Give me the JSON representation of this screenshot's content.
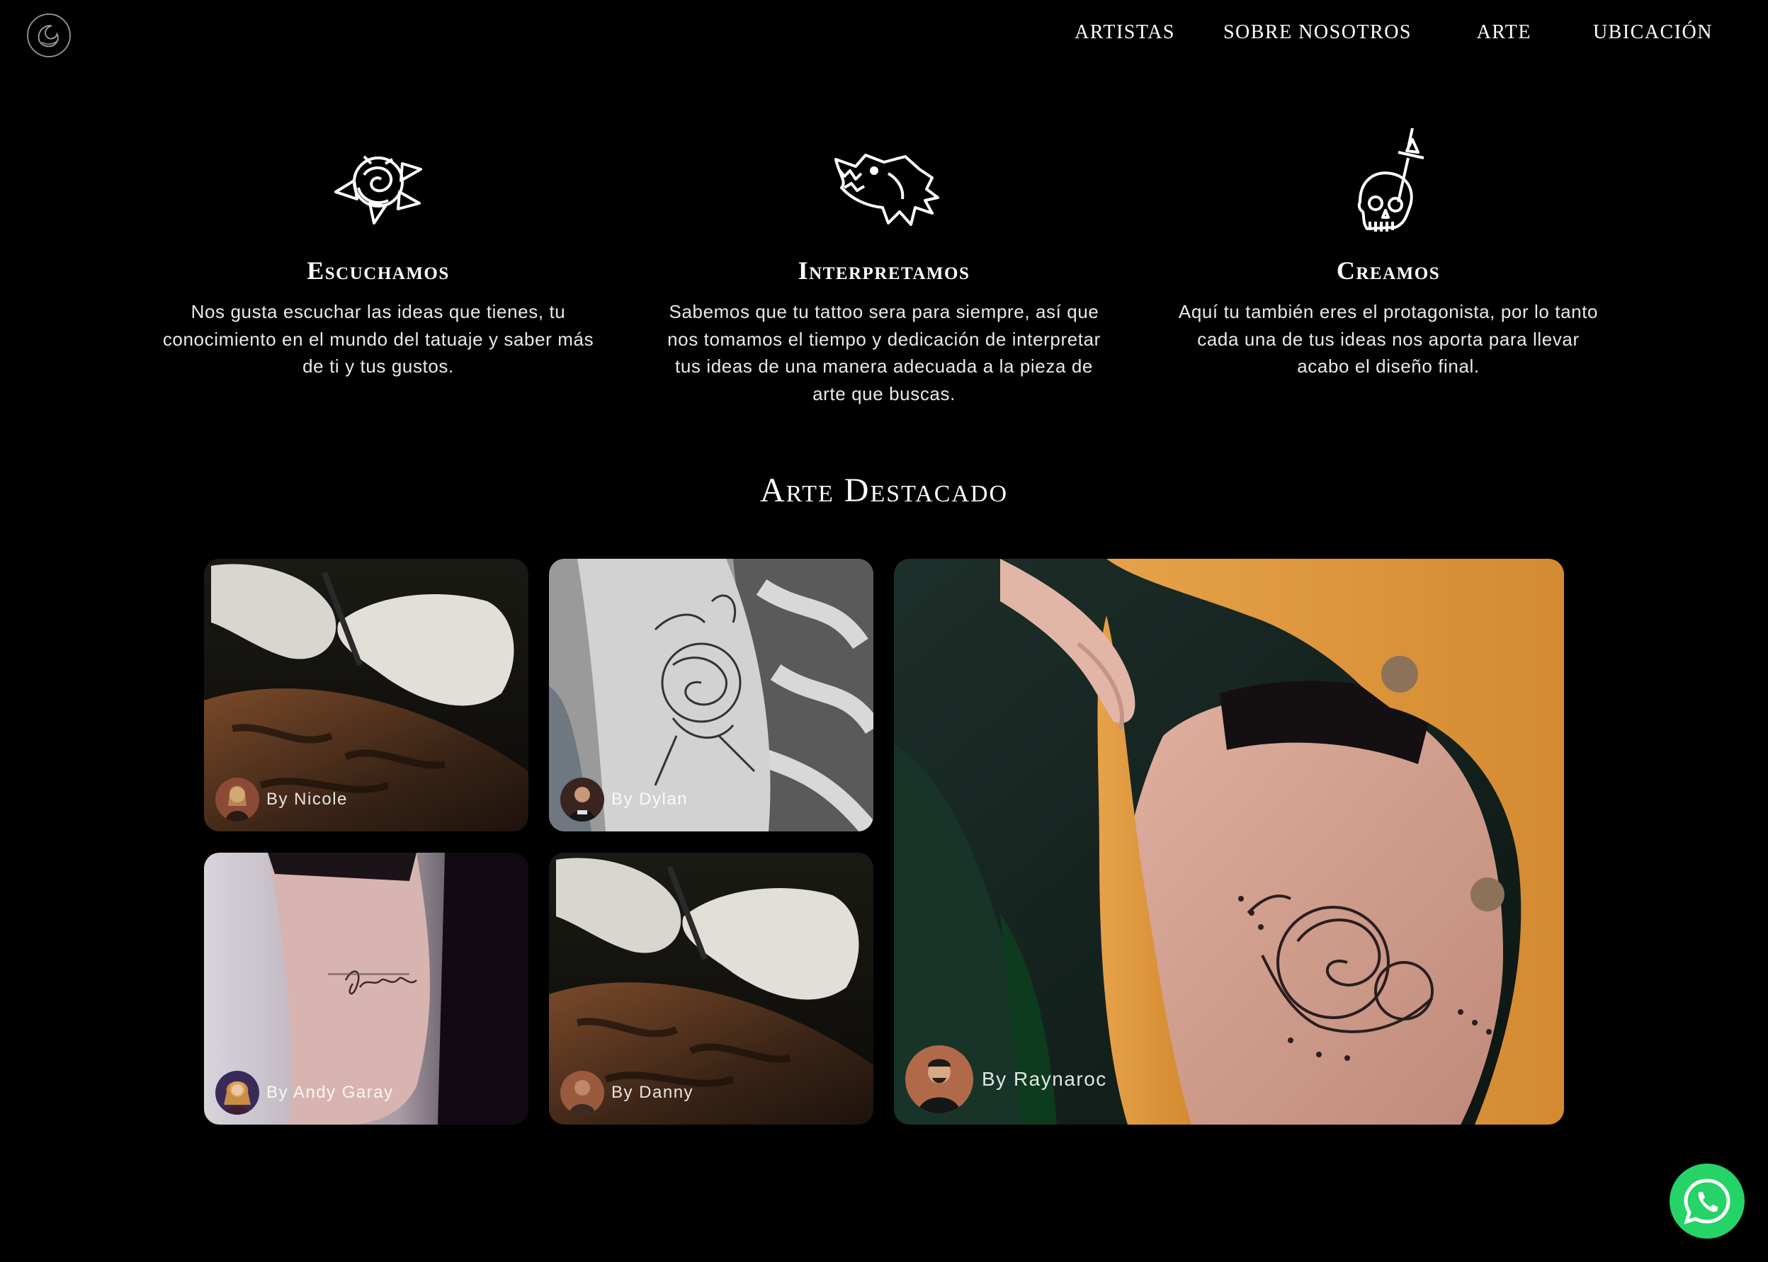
{
  "header": {
    "nav": [
      "ARTISTAS",
      "SOBRE NOSOTROS",
      "ARTE",
      "UBICACIÓN"
    ]
  },
  "features": [
    {
      "icon": "rose-icon",
      "title": "Escuchamos",
      "text": "Nos gusta escuchar las ideas que tienes, tu conocimiento en el mundo del tatuaje y saber más de ti y tus gustos."
    },
    {
      "icon": "wolf-head-icon",
      "title": "Interpretamos",
      "text": "Sabemos que tu tattoo sera para siempre, así que nos tomamos el tiempo y dedicación de interpretar tus ideas de una manera adecuada a la pieza de arte que buscas."
    },
    {
      "icon": "skull-dagger-icon",
      "title": "Creamos",
      "text": "Aquí tu también eres el protagonista, por lo tanto cada una de tus ideas nos aporta para llevar acabo el diseño final."
    }
  ],
  "gallery": {
    "title": "Arte Destacado",
    "items": [
      {
        "credit": "By Nicole"
      },
      {
        "credit": "By Dylan"
      },
      {
        "credit": "By Andy Garay"
      },
      {
        "credit": "By Danny"
      },
      {
        "credit": "By Raynaroc"
      }
    ]
  },
  "colors": {
    "background": "#000000",
    "whatsapp": "#25d366"
  }
}
